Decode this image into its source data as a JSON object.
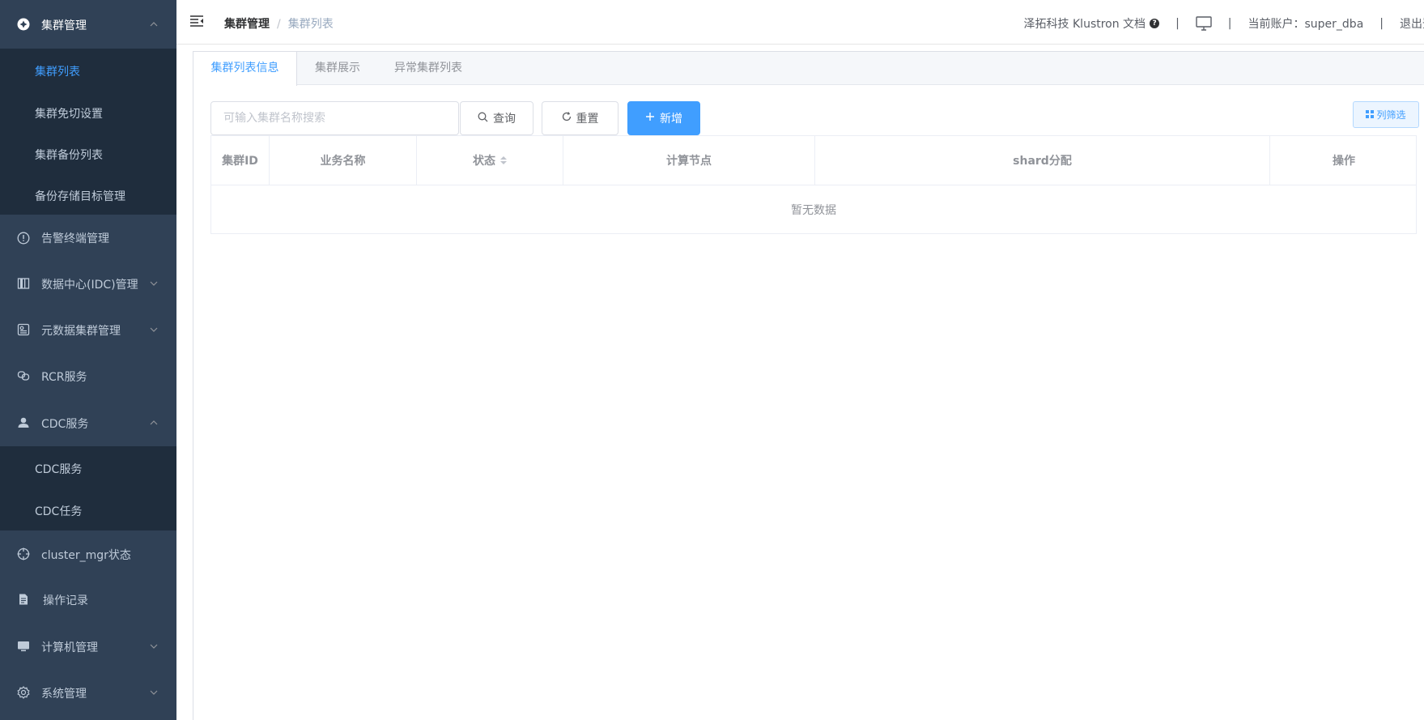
{
  "sidebar": {
    "groups": {
      "cluster_mgmt": {
        "label": "集群管理",
        "icon": "cluster-icon"
      },
      "alarm": {
        "label": "告警终端管理",
        "icon": "alert-icon"
      },
      "idc": {
        "label": "数据中心(IDC)管理",
        "icon": "building-icon"
      },
      "meta": {
        "label": "元数据集群管理",
        "icon": "meta-data-icon"
      },
      "rcr": {
        "label": "RCR服务",
        "icon": "link-icon"
      },
      "cdc": {
        "label": "CDC服务",
        "icon": "user-icon"
      },
      "cluster_mgr": {
        "label": "cluster_mgr状态",
        "icon": "crosshair-icon"
      },
      "oplog": {
        "label": "操作记录",
        "icon": "document-icon"
      },
      "machine": {
        "label": "计算机管理",
        "icon": "monitor-icon"
      },
      "system": {
        "label": "系统管理",
        "icon": "gear-icon"
      }
    },
    "cluster_sub": [
      "集群列表",
      "集群免切设置",
      "集群备份列表",
      "备份存储目标管理"
    ],
    "cdc_sub": [
      "CDC服务",
      "CDC任务"
    ]
  },
  "header": {
    "breadcrumb": {
      "parent": "集群管理",
      "separator": "/",
      "current": "集群列表"
    },
    "docs_link": "泽拓科技 Klustron 文档",
    "separator": "|",
    "account_label": "当前账户：super_dba",
    "logout": "退出登录"
  },
  "tabs": [
    "集群列表信息",
    "集群展示",
    "异常集群列表"
  ],
  "toolbar": {
    "search_placeholder": "可输入集群名称搜索",
    "search_button": "查询",
    "reset_button": "重置",
    "add_button": "新增",
    "column_filter_button": "列筛选"
  },
  "table": {
    "columns": [
      "集群ID",
      "业务名称",
      "状态",
      "计算节点",
      "shard分配",
      "操作"
    ],
    "empty_text": "暂无数据"
  },
  "colors": {
    "sidebar_bg": "#304156",
    "submenu_bg": "#1f2d3d",
    "accent": "#409eff"
  }
}
